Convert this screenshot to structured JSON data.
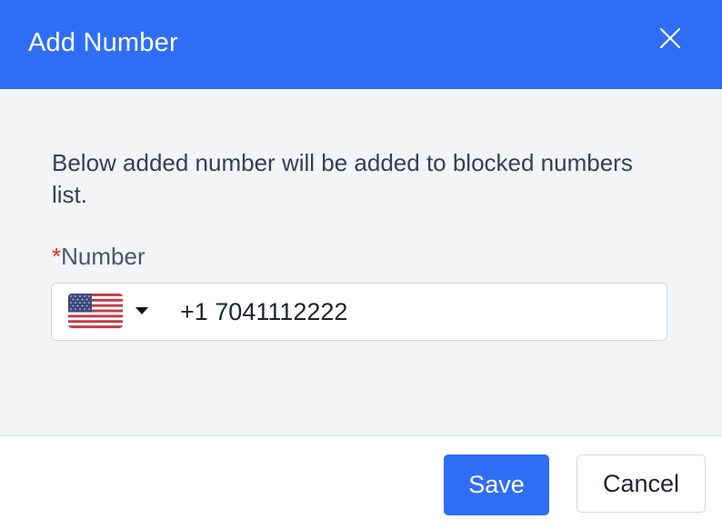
{
  "dialog": {
    "title": "Add Number",
    "close_icon": "close-icon"
  },
  "body": {
    "description": "Below added number will be added to blocked numbers list.",
    "field": {
      "required_marker": "*",
      "label": "Number",
      "country_flag": "us-flag-icon",
      "country_caret_icon": "caret-down-icon",
      "value": "+1 7041112222"
    }
  },
  "footer": {
    "save_label": "Save",
    "cancel_label": "Cancel"
  },
  "colors": {
    "header_bg": "#2f6ef4",
    "body_bg": "#f3f4f6",
    "primary_button": "#2f6ef4",
    "required": "#d6322a"
  }
}
